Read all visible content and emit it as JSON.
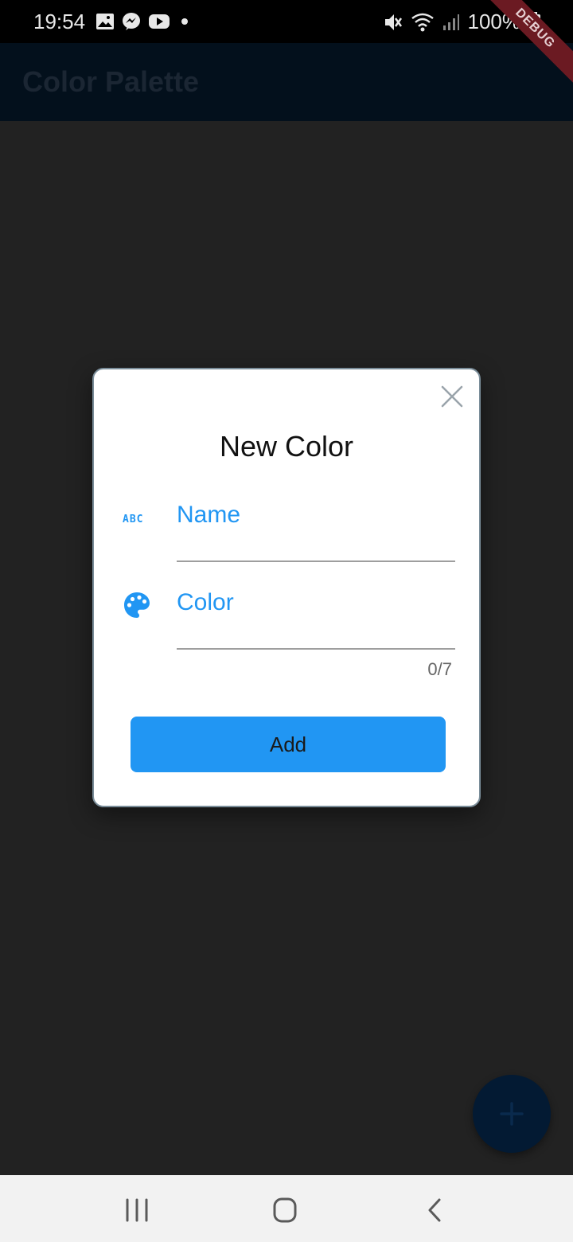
{
  "status_bar": {
    "time": "19:54",
    "battery": "100%",
    "left_icons": [
      "image-icon",
      "messenger-icon",
      "youtube-icon",
      "dot-icon"
    ],
    "right_icons": [
      "mute-icon",
      "wifi-icon",
      "signal-icon",
      "battery-icon"
    ]
  },
  "app_bar": {
    "title": "Color Palette"
  },
  "debug_ribbon": {
    "label": "DEBUG"
  },
  "dialog": {
    "title": "New Color",
    "close_icon": "close-icon",
    "fields": [
      {
        "label": "Name",
        "icon": "abc-icon"
      },
      {
        "label": "Color",
        "icon": "palette-icon",
        "counter": "0/7"
      }
    ],
    "submit_label": "Add"
  },
  "fab": {
    "icon": "plus-icon"
  },
  "nav_bar": {
    "buttons": [
      "recent-apps-icon",
      "home-icon",
      "back-icon"
    ]
  },
  "colors": {
    "accent": "#2196f3",
    "background": "#222222",
    "app_bar": "#03101c",
    "fab": "#031a33",
    "ribbon": "#6b1a22"
  }
}
